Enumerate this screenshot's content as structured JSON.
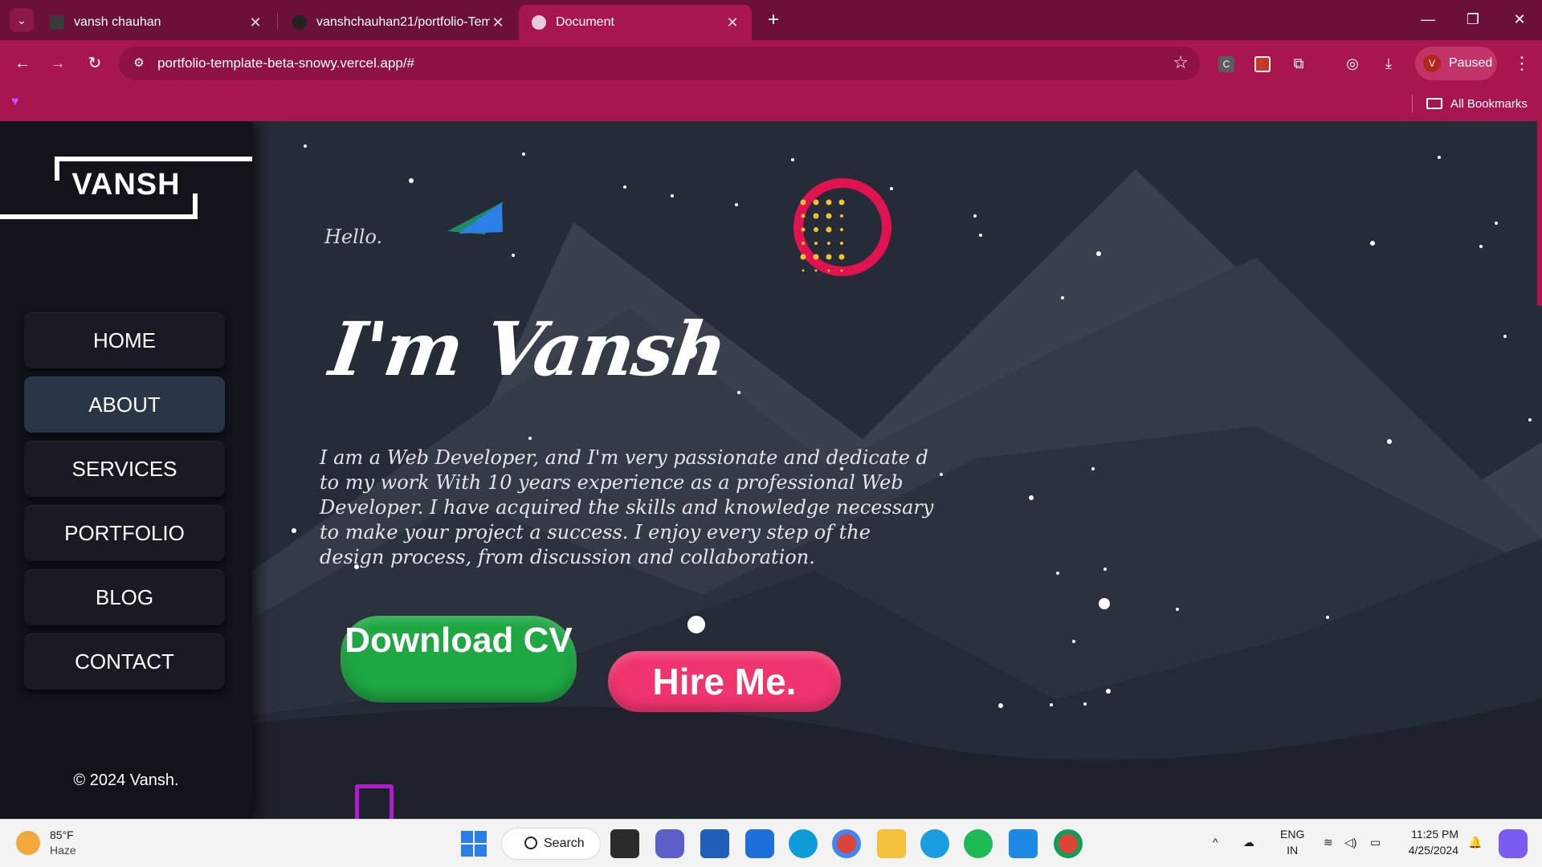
{
  "browser": {
    "tabs": [
      {
        "title": "vansh chauhan",
        "active": false
      },
      {
        "title": "vanshchauhan21/portfolio-Tem",
        "active": false
      },
      {
        "title": "Document",
        "active": true
      }
    ],
    "url": "portfolio-template-beta-snowy.vercel.app/#",
    "profile_initial": "V",
    "profile_status": "Paused",
    "ext_c_label": "C",
    "bookmarks_label": "All Bookmarks",
    "colors": {
      "tabbar": "#6b1039",
      "toolbar": "#a8164f"
    }
  },
  "sidebar": {
    "logo": "VANSH",
    "nav": [
      {
        "label": "HOME",
        "active": false
      },
      {
        "label": "ABOUT",
        "active": true
      },
      {
        "label": "SERVICES",
        "active": false
      },
      {
        "label": "PORTFOLIO",
        "active": false
      },
      {
        "label": "BLOG",
        "active": false
      },
      {
        "label": "CONTACT",
        "active": false
      }
    ],
    "copyright": "© 2024 Vansh."
  },
  "hero": {
    "greeting": "Hello.",
    "headline": "I'm Vansh",
    "intro": "I am a Web Developer, and I'm very passionate and dedicate d to my work With 10 years experience as a professional Web Developer. I have acquired the skills and knowledge necessary to make your project a success. I enjoy every step of the design process, from discussion and collaboration.",
    "cta_primary": "Download CV",
    "cta_secondary": "Hire Me.",
    "colors": {
      "primary_button": "#1ea743",
      "secondary_button": "#f0346e",
      "ring": "#e0124f",
      "dots": "#f2c230"
    }
  },
  "taskbar": {
    "weather_temp": "85°F",
    "weather_desc": "Haze",
    "search_label": "Search",
    "lang_top": "ENG",
    "lang_bottom": "IN",
    "time": "11:25 PM",
    "date": "4/25/2024"
  }
}
